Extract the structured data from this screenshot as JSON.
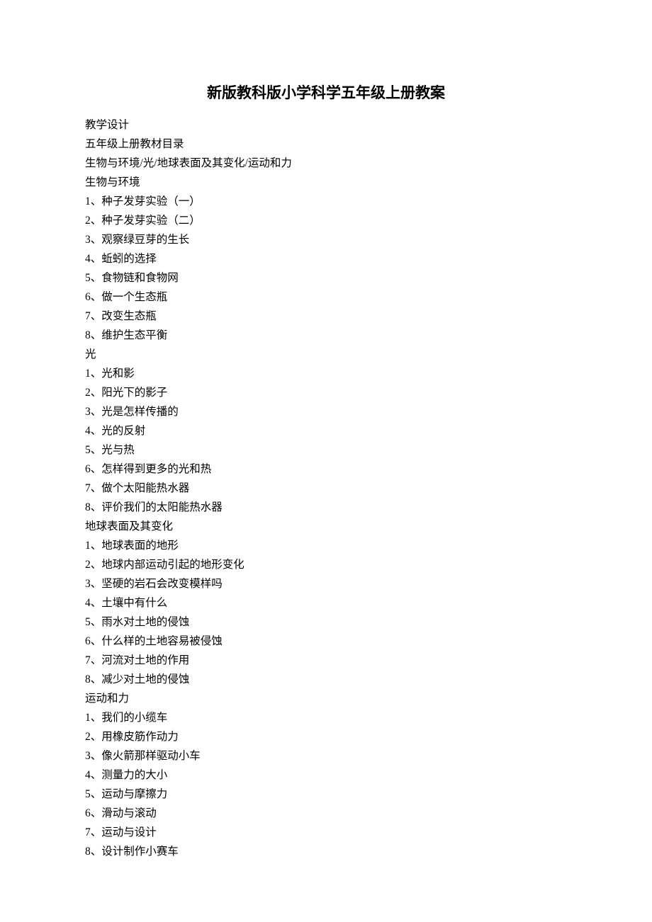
{
  "title": "新版教科版小学科学五年级上册教案",
  "lines": [
    "教学设计",
    "五年级上册教材目录",
    "生物与环境/光/地球表面及其变化/运动和力",
    "生物与环境",
    "1、种子发芽实验（一）",
    "2、种子发芽实验（二）",
    "3、观察绿豆芽的生长",
    "4、蚯蚓的选择",
    "5、食物链和食物网",
    "6、做一个生态瓶",
    "7、改变生态瓶",
    "8、维护生态平衡",
    "光",
    "1、光和影",
    "2、阳光下的影子",
    "3、光是怎样传播的",
    "4、光的反射",
    "5、光与热",
    "6、怎样得到更多的光和热",
    "7、做个太阳能热水器",
    "8、评价我们的太阳能热水器",
    "地球表面及其变化",
    "1、地球表面的地形",
    "2、地球内部运动引起的地形变化",
    "3、坚硬的岩石会改变模样吗",
    "4、土壤中有什么",
    "5、雨水对土地的侵蚀",
    "6、什么样的土地容易被侵蚀",
    "7、河流对土地的作用",
    "8、减少对土地的侵蚀",
    "运动和力",
    "1、我们的小缆车",
    "2、用橡皮筋作动力",
    "3、像火箭那样驱动小车",
    "4、测量力的大小",
    "5、运动与摩擦力",
    "6、滑动与滚动",
    "7、运动与设计",
    "8、设计制作小赛车"
  ]
}
